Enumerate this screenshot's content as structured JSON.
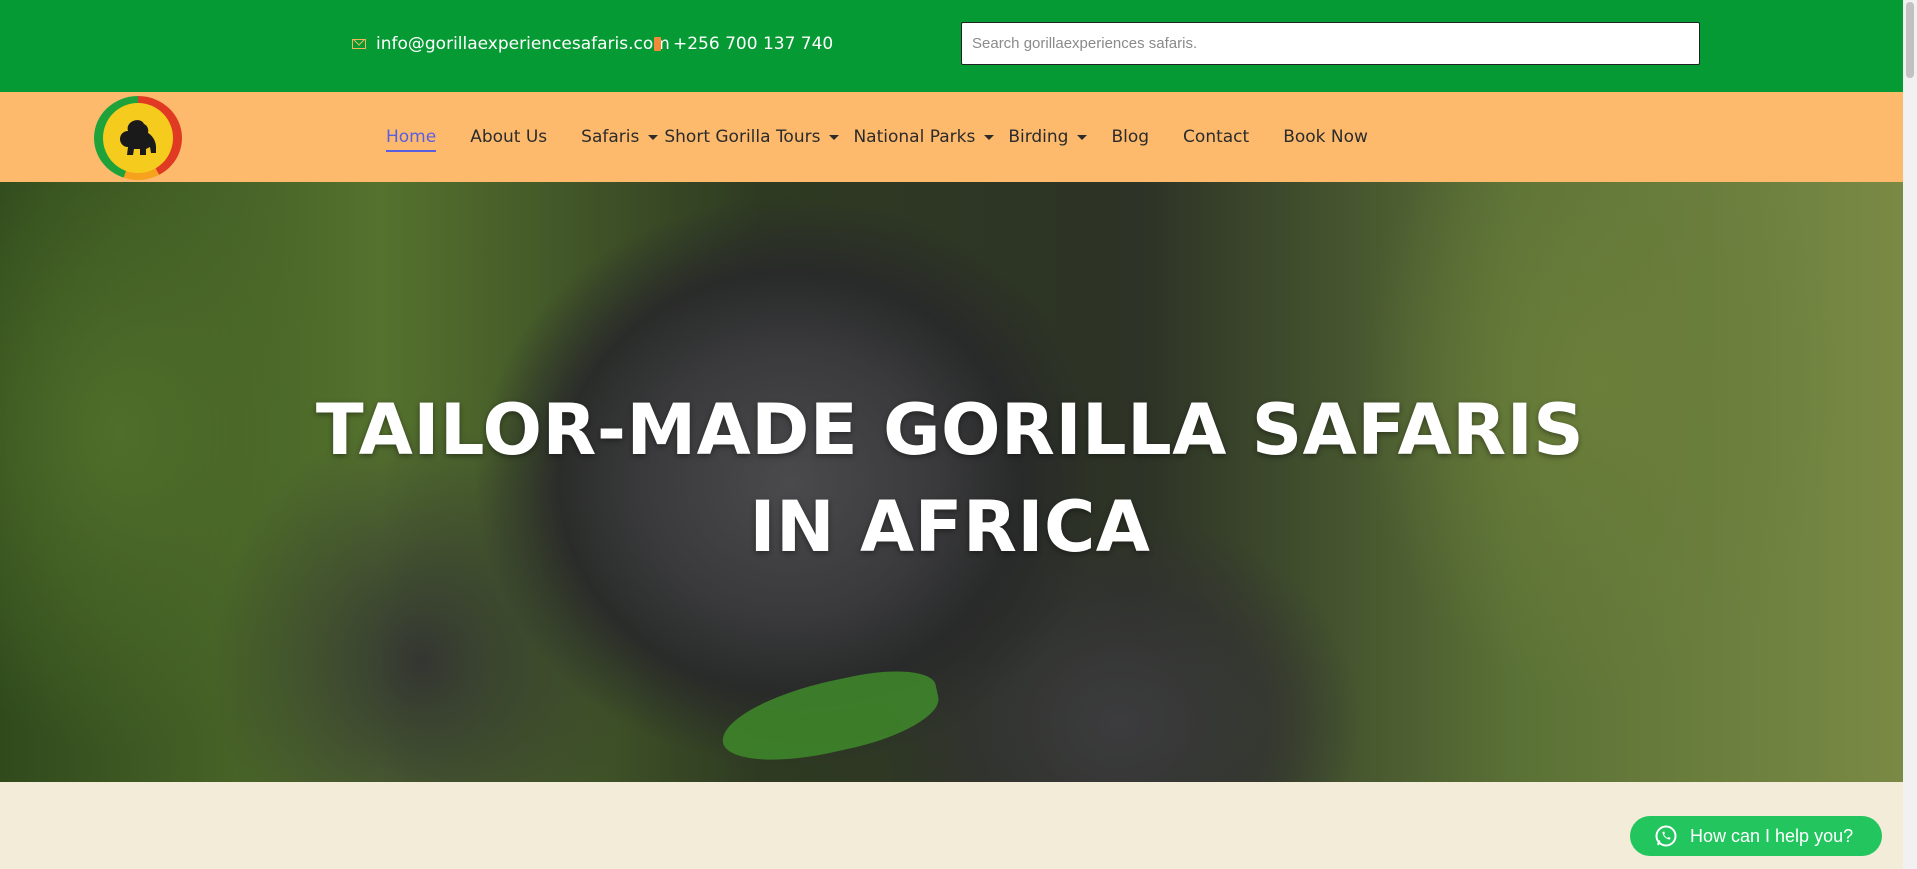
{
  "topbar": {
    "email": "info@gorillaexperiencesafaris.com",
    "phone": "+256 700 137 740",
    "search_placeholder": "Search gorillaexperiences safaris.",
    "bg_color": "#069a34"
  },
  "logo": {
    "icon": "gorilla-icon"
  },
  "nav": {
    "items": [
      {
        "label": "Home",
        "active": true,
        "dropdown": false
      },
      {
        "label": "About Us",
        "active": false,
        "dropdown": false
      },
      {
        "label": "Safaris",
        "active": false,
        "dropdown": true
      },
      {
        "label": "Short Gorilla Tours",
        "active": false,
        "dropdown": true
      },
      {
        "label": "National Parks",
        "active": false,
        "dropdown": true
      },
      {
        "label": "Birding",
        "active": false,
        "dropdown": true
      },
      {
        "label": "Blog",
        "active": false,
        "dropdown": false
      },
      {
        "label": "Contact",
        "active": false,
        "dropdown": false
      },
      {
        "label": "Book Now",
        "active": false,
        "dropdown": false
      }
    ],
    "bg_color": "#fdba6d",
    "active_color": "#5a5fe0"
  },
  "hero": {
    "title": "TAILOR-MADE GORILLA SAFARIS IN AFRICA"
  },
  "chat": {
    "label": "How can I help you?",
    "icon": "whatsapp-icon",
    "color": "#22c55e"
  }
}
